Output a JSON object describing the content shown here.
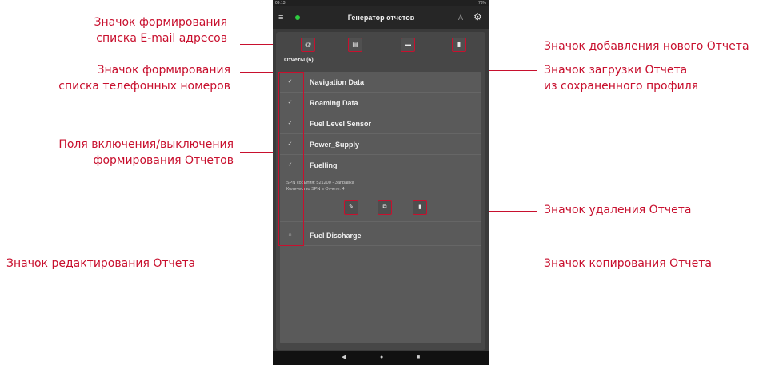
{
  "callouts": {
    "email": "Значок формирования\nсписка E-mail адресов",
    "phones": "Значок формирования\nсписка телефонных номеров",
    "toggles": "Поля включения/выключения\nформирования Отчетов",
    "edit": "Значок редактирования Отчета",
    "add": "Значок добавления нового Отчета",
    "load": "Значок загрузки Отчета\nиз сохраненного профиля",
    "delete": "Значок удаления Отчета",
    "copy": "Значок копирования Отчета"
  },
  "status_bar": {
    "time": "09:13",
    "right": "73%"
  },
  "app_bar": {
    "title": "Генератор отчетов",
    "font_label": "A"
  },
  "reports": {
    "header": "Отчеты (6)",
    "items": [
      {
        "name": "Navigation Data",
        "enabled": true
      },
      {
        "name": "Roaming Data",
        "enabled": true
      },
      {
        "name": "Fuel Level Sensor",
        "enabled": true
      },
      {
        "name": "Power_Supply",
        "enabled": true
      },
      {
        "name": "Fuelling",
        "enabled": true
      },
      {
        "name": "Fuel Discharge",
        "enabled": false
      }
    ],
    "expanded_info": {
      "line1": "SPN события: 521200 - Заправка",
      "line2": "Количество SPN в Отчете: 4"
    }
  },
  "icons": {
    "toolbar": [
      "at-icon",
      "contact-card-icon",
      "folder-icon",
      "new-document-icon"
    ],
    "actions": [
      "edit-icon",
      "copy-icon",
      "delete-icon"
    ]
  },
  "colors": {
    "annotation": "#c8102e",
    "panel": "#474747",
    "list": "#5a5a5a",
    "appbar": "#262626"
  }
}
